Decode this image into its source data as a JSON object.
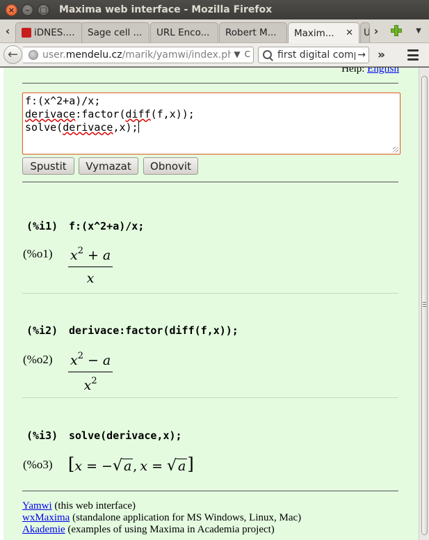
{
  "window": {
    "title": "Maxima web interface - Mozilla Firefox",
    "close_glyph": "×",
    "min_glyph": "–",
    "max_glyph": "□"
  },
  "tabs": [
    {
      "label": "iDNES...."
    },
    {
      "label": "Sage cell ..."
    },
    {
      "label": "URL Enco..."
    },
    {
      "label": "Robert M..."
    },
    {
      "label": "Maxim...",
      "active": true
    },
    {
      "label": "U"
    }
  ],
  "tab_controls": {
    "left": "‹",
    "right": "›",
    "close": "✕",
    "menu": "▼"
  },
  "navbar": {
    "back": "←",
    "url_prefix": "user.",
    "url_domain": "mendelu.cz",
    "url_path": "/marik/yamwi/index.ph",
    "url_dropdown": "▼",
    "reload": "C",
    "search_value": "first digital compu",
    "search_go": "→",
    "overflow": "»"
  },
  "page": {
    "help_prefix": "Help: ",
    "help_link": "English",
    "editor_lines": {
      "l1": "f:(x^2+a)/x;",
      "l2a": "derivace",
      "l2b": ":factor(",
      "l2c": "diff",
      "l2d": "(f,x));",
      "l3a": "solve(",
      "l3b": "derivace",
      "l3c": ",x);"
    },
    "buttons": {
      "run": "Spustit",
      "clear": "Vymazat",
      "reload": "Obnovit"
    },
    "cells": [
      {
        "in_label": "(%i1)",
        "in_code": "f:(x^2+a)/x;",
        "out_label": "(%o1)",
        "num_base": "x",
        "num_exp": "2",
        "num_op": "+",
        "num_var": "a",
        "den_base": "x",
        "den_exp": ""
      },
      {
        "in_label": "(%i2)",
        "in_code": "derivace:factor(diff(f,x));",
        "out_label": "(%o2)",
        "num_base": "x",
        "num_exp": "2",
        "num_op": "−",
        "num_var": "a",
        "den_base": "x",
        "den_exp": "2"
      },
      {
        "in_label": "(%i3)",
        "in_code": "solve(derivace,x);",
        "out_label": "(%o3)",
        "open": "[",
        "x1": "x",
        "eq1": "=",
        "neg": "−",
        "sqrt1": "a",
        "comma": ",",
        "x2": "x",
        "eq2": "=",
        "sqrt2": "a",
        "close": "]"
      }
    ],
    "footer": [
      {
        "link": "Yamwi",
        "text": " (this web interface)"
      },
      {
        "link": "wxMaxima",
        "text": " (standalone application for MS Windows, Linux, Mac)"
      },
      {
        "link": "Akademie",
        "text": " (examples of using Maxima in Academia project)"
      }
    ]
  }
}
